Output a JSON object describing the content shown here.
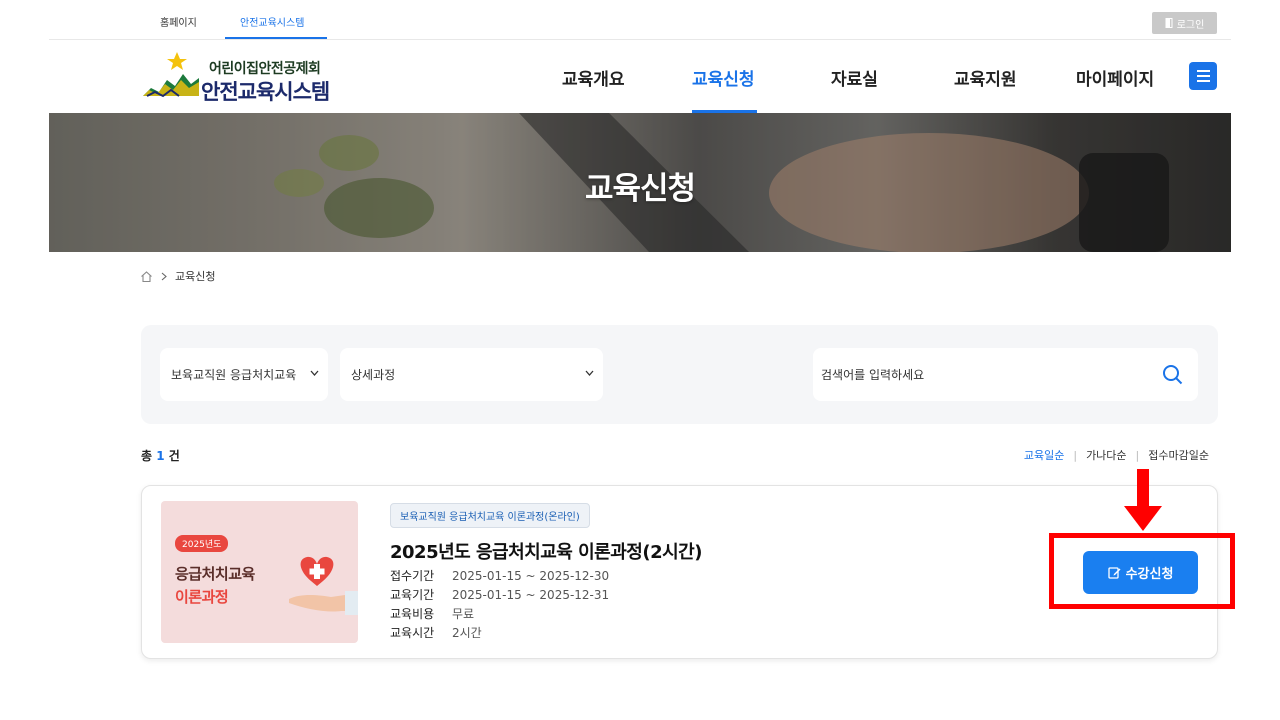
{
  "topbar": {
    "tabs": [
      "홈페이지",
      "안전교육시스템"
    ],
    "login_label": "로그인"
  },
  "header": {
    "logo_sub": "어린이집안전공제회",
    "logo_main": "안전교육시스템",
    "nav": [
      "교육개요",
      "교육신청",
      "자료실",
      "교육지원",
      "마이페이지"
    ]
  },
  "banner": {
    "title": "교육신청"
  },
  "breadcrumb": {
    "current": "교육신청"
  },
  "filters": {
    "category": "보육교직원 응급처치교육",
    "detail": "상세과정",
    "search_placeholder": "검색어를 입력하세요"
  },
  "results": {
    "total_prefix": "총",
    "total_count": "1",
    "total_suffix": "건",
    "sorts": [
      "교육일순",
      "가나다순",
      "접수마감일순"
    ]
  },
  "course": {
    "thumb_year": "2025년도",
    "thumb_line1": "응급처치교육",
    "thumb_line2": "이론과정",
    "badge": "보육교직원 응급처치교육 이론과정(온라인)",
    "title": "2025년도 응급처치교육 이론과정(2시간)",
    "info": [
      {
        "k": "접수기간",
        "v": "2025-01-15 ~ 2025-12-30"
      },
      {
        "k": "교육기간",
        "v": "2025-01-15 ~ 2025-12-31"
      },
      {
        "k": "교육비용",
        "v": "무료"
      },
      {
        "k": "교육시간",
        "v": "2시간"
      }
    ],
    "enroll_label": "수강신청"
  },
  "colors": {
    "accent": "#1a73e8",
    "button": "#1a7ff0",
    "highlight": "#ff0000"
  },
  "icons": [
    "door-icon",
    "menu-icon",
    "home-icon",
    "chevron-right-icon",
    "chevron-down-icon",
    "search-icon",
    "edit-icon",
    "heart-icon",
    "hand-icon",
    "down-arrow-icon"
  ]
}
